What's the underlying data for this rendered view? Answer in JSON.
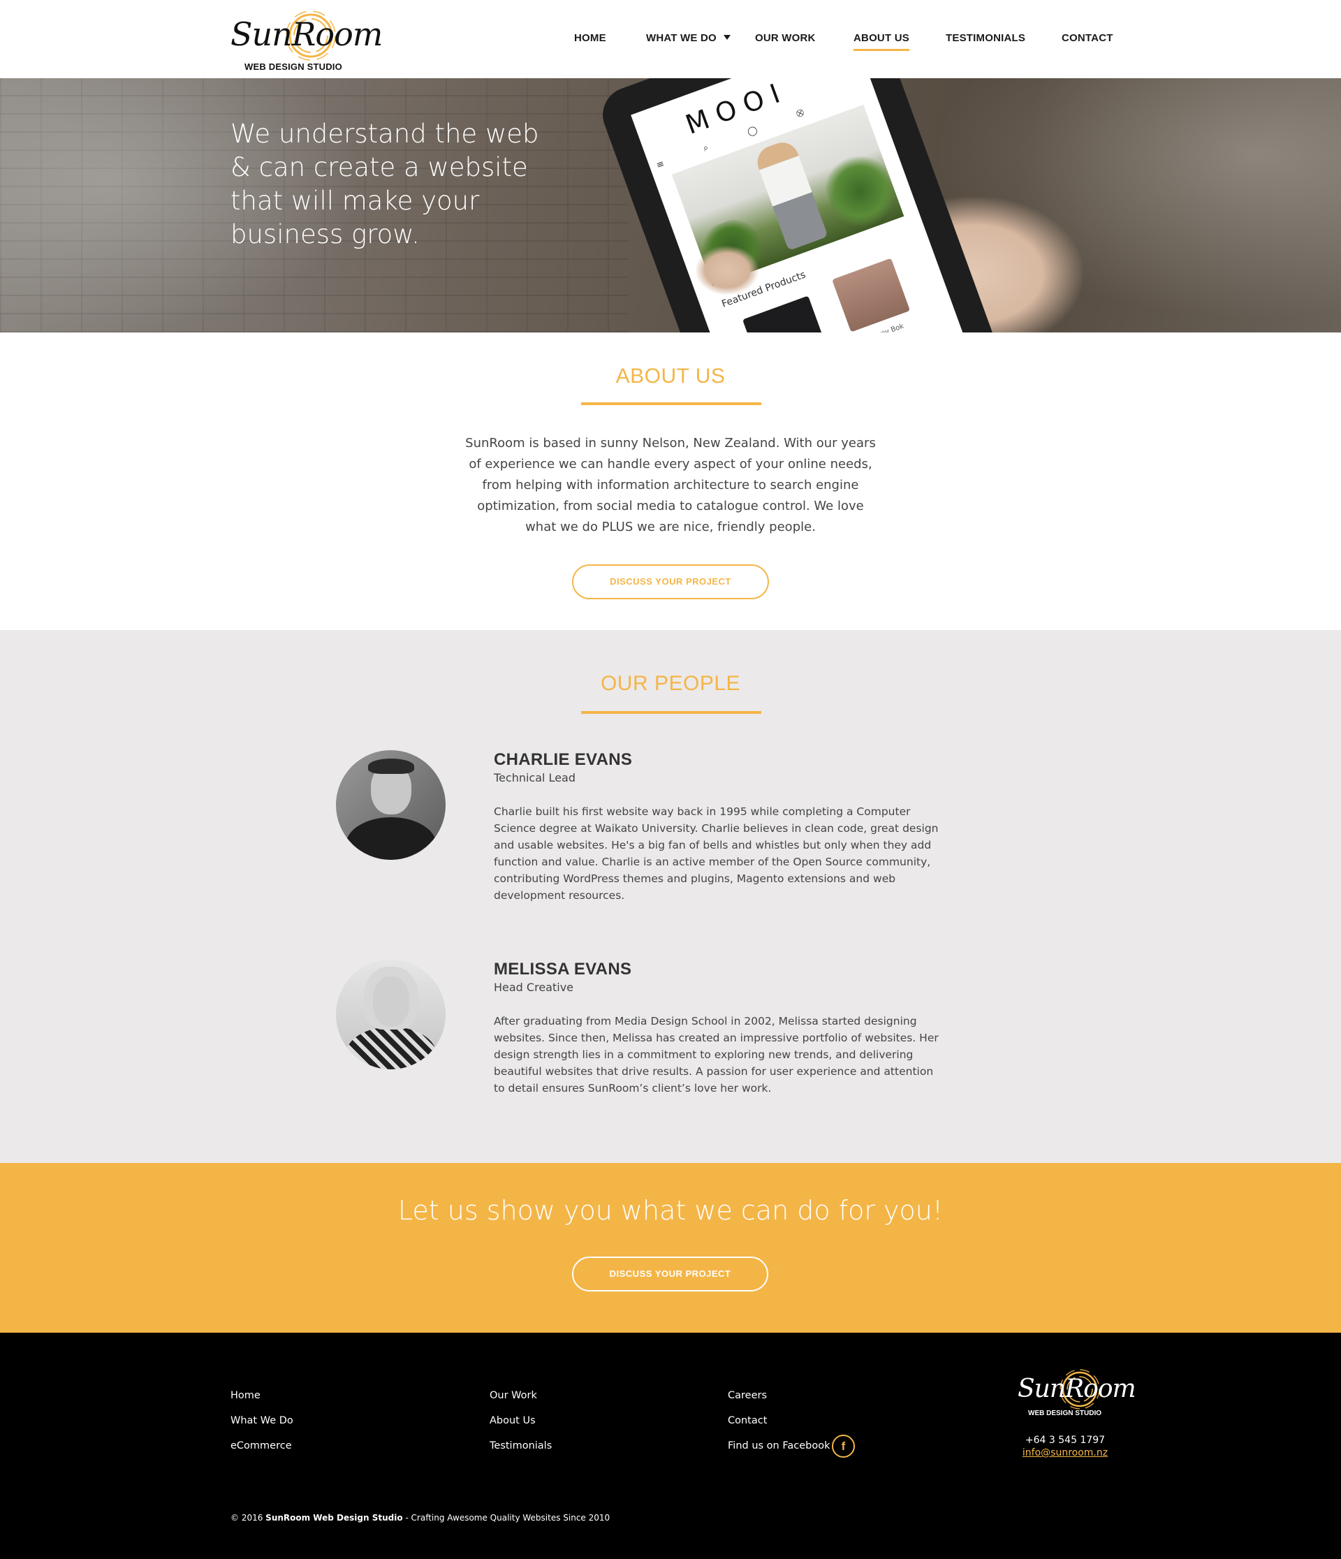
{
  "brand": {
    "name": "SunRoom",
    "tagline": "WEB DESIGN STUDIO",
    "accent_color": "#f4b547"
  },
  "nav": {
    "items": [
      {
        "label": "HOME"
      },
      {
        "label": "WHAT WE DO",
        "has_dropdown": true
      },
      {
        "label": "OUR WORK"
      },
      {
        "label": "ABOUT US",
        "active": true
      },
      {
        "label": "TESTIMONIALS"
      },
      {
        "label": "CONTACT"
      }
    ]
  },
  "hero": {
    "headline": "We understand the web & can create a website that will make your business grow.",
    "phone_screen": {
      "brand": "MOOI",
      "section": "Featured Products",
      "product_caption": "Jem Grey Bok"
    }
  },
  "about": {
    "title": "ABOUT US",
    "body": "SunRoom is based in sunny Nelson, New Zealand. With our years of experience we can handle every aspect of your online needs, from helping with information architecture to search engine optimization, from social media to catalogue control. We love what we do PLUS we are nice, friendly people.",
    "button_label": "DISCUSS YOUR PROJECT"
  },
  "people": {
    "title": "OUR PEOPLE",
    "members": [
      {
        "name": "CHARLIE EVANS",
        "role": "Technical Lead",
        "bio": "Charlie built his first website way back in 1995 while completing a Computer Science degree at Waikato University. Charlie believes in clean code, great design and usable websites. He's a big fan of bells and whistles but only when they add function and value. Charlie is an active member of the Open Source community, contributing WordPress themes and plugins, Magento extensions and web development resources."
      },
      {
        "name": "MELISSA EVANS",
        "role": "Head Creative",
        "bio": "After graduating from Media Design School in 2002, Melissa started designing websites. Since then, Melissa has created an impressive portfolio of websites. Her design strength lies in a commitment to exploring new trends, and delivering beautiful websites that drive results. A passion for user experience and attention to detail ensures SunRoom’s client’s love her work."
      }
    ]
  },
  "cta": {
    "headline": "Let us show you what we can do for you!",
    "button_label": "DISCUSS YOUR PROJECT"
  },
  "footer": {
    "col1": [
      "Home",
      "What We Do",
      "eCommerce"
    ],
    "col2": [
      "Our Work",
      "About Us",
      "Testimonials"
    ],
    "col3": [
      "Careers",
      "Contact",
      "Find us on Facebook"
    ],
    "facebook_icon": "f",
    "phone": "+64 3 545 1797",
    "email": "info@sunroom.nz",
    "copyright_prefix": "© 2016 ",
    "copyright_company": "SunRoom Web Design Studio",
    "copyright_suffix": " - Crafting Awesome Quality Websites Since 2010"
  }
}
